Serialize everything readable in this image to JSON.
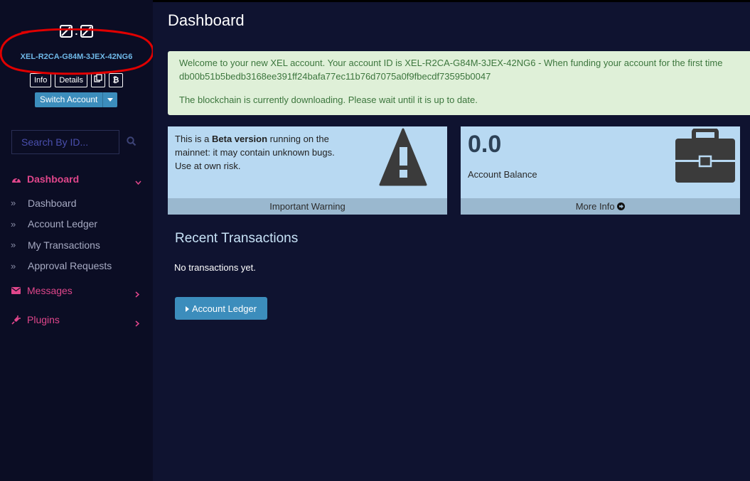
{
  "sidebar": {
    "logo_icons": [
      "broken-image-icon",
      "broken-image-icon"
    ],
    "logo_separator": ".",
    "account_id": "XEL-R2CA-G84M-3JEX-42NG6",
    "buttons": {
      "info": "Info",
      "details": "Details"
    },
    "switch_account": "Switch Account",
    "search_placeholder": "Search By ID...",
    "menu": {
      "dashboard": {
        "label": "Dashboard",
        "items": [
          "Dashboard",
          "Account Ledger",
          "My Transactions",
          "Approval Requests"
        ]
      },
      "messages": "Messages",
      "plugins": "Plugins"
    },
    "item_marker": "»"
  },
  "main": {
    "title": "Dashboard",
    "alert": {
      "line1": "Welcome to your new XEL account. Your account ID is XEL-R2CA-G84M-3JEX-42NG6 - When funding your account for the first time",
      "line2": "db00b51b5bedb3168ee391ff24bafa77ec11b76d7075a0f9fbecdf73595b0047",
      "line3": "The blockchain is currently downloading. Please wait until it is up to date."
    },
    "warning_box": {
      "text_pre": "This is a ",
      "text_bold": "Beta version",
      "text_post": " running on the mainnet: it may contain unknown bugs. Use at own risk.",
      "footer": "Important Warning"
    },
    "balance_box": {
      "value": "0.0",
      "label": "Account Balance",
      "footer": "More Info"
    },
    "recent_transactions": {
      "title": "Recent Transactions",
      "empty": "No transactions yet.",
      "button": "Account Ledger"
    }
  },
  "colors": {
    "page_bg": "#0f1330",
    "sidebar_bg": "#0b0d24",
    "accent_pink": "#e0468b",
    "primary_blue": "#3c8dbc",
    "alert_green_bg": "#dff0d8",
    "alert_green_text": "#3c763d",
    "info_box_bg": "#b8d9f2",
    "annotation_red": "#e00000"
  }
}
